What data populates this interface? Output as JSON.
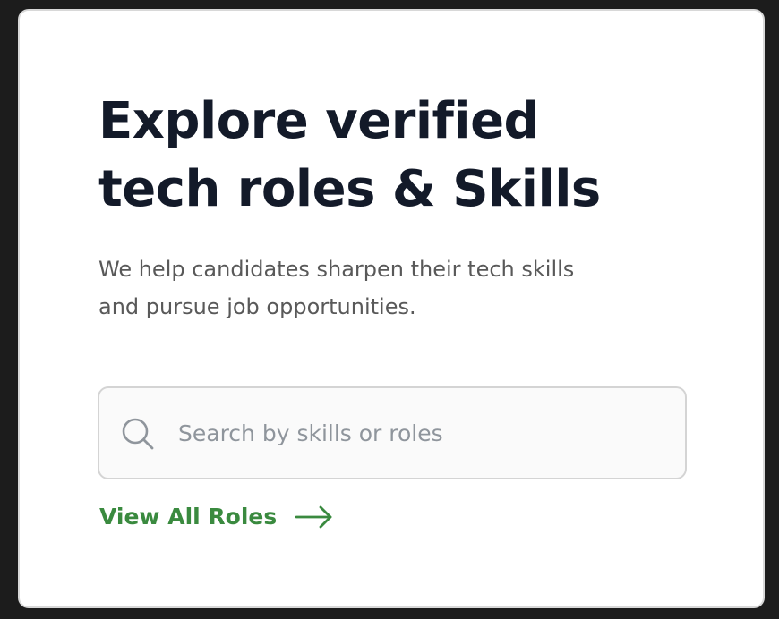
{
  "hero": {
    "title_line1": "Explore verified",
    "title_line2": "tech roles & Skills",
    "subtitle_line1": "We help candidates sharpen their tech skills",
    "subtitle_line2": "and pursue job opportunities."
  },
  "search": {
    "placeholder": "Search by skills or roles",
    "value": "",
    "icon": "search-icon"
  },
  "link": {
    "label": "View All Roles",
    "icon": "arrow-right-icon"
  },
  "colors": {
    "title": "#131a29",
    "subtitle": "#595959",
    "accent_green": "#3a8a3f",
    "placeholder": "#8f959c",
    "backdrop": "#1c1c1c",
    "card": "#ffffff"
  }
}
